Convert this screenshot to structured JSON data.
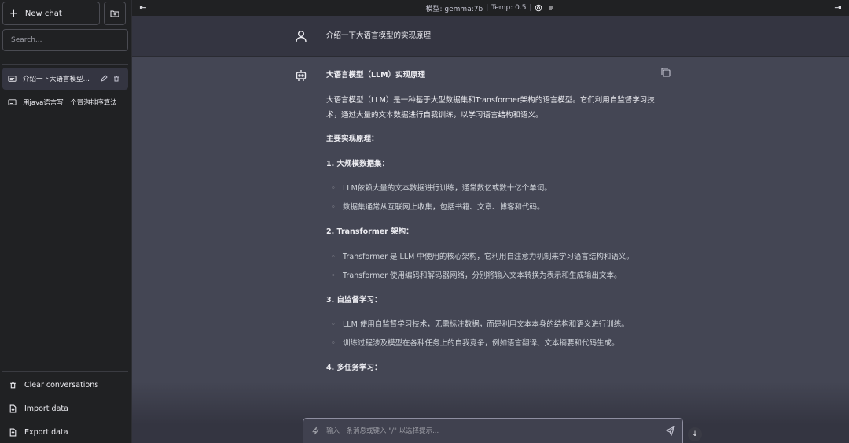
{
  "sidebar": {
    "new_chat_label": "New chat",
    "search_placeholder": "Search...",
    "conversations": [
      {
        "label": "介绍一下大语言模型的..."
      },
      {
        "label": "用java语言写一个冒泡排序算法"
      }
    ],
    "bottom": {
      "clear": "Clear conversations",
      "import": "Import data",
      "export": "Export data"
    }
  },
  "topbar": {
    "model": "模型: gemma:7b",
    "temp": "Temp: 0.5"
  },
  "user_message": "介绍一下大语言模型的实现原理",
  "assistant": {
    "title": "大语言模型（LLM）实现原理",
    "intro": "大语言模型（LLM）是一种基于大型数据集和Transformer架构的语言模型。它们利用自监督学习技术，通过大量的文本数据进行自我训练，以学习语言结构和语义。",
    "main_heading": "主要实现原理：",
    "sections": [
      {
        "heading": "1. 大规模数据集：",
        "items": [
          "LLM依赖大量的文本数据进行训练，通常数亿或数十亿个单词。",
          "数据集通常从互联网上收集，包括书籍、文章、博客和代码。"
        ]
      },
      {
        "heading": "2. Transformer 架构：",
        "items": [
          "Transformer 是 LLM 中使用的核心架构，它利用自注意力机制来学习语言结构和语义。",
          "Transformer 使用编码和解码器网络，分别将输入文本转换为表示和生成输出文本。"
        ]
      },
      {
        "heading": "3. 自监督学习：",
        "items": [
          "LLM 使用自监督学习技术，无需标注数据，而是利用文本本身的结构和语义进行训练。",
          "训练过程涉及模型在各种任务上的自我竞争，例如语言翻译、文本摘要和代码生成。"
        ]
      },
      {
        "heading": "4. 多任务学习：",
        "items": []
      }
    ]
  },
  "input": {
    "placeholder": "输入一条消息或键入 \"/\" 以选择提示..."
  },
  "icons": {
    "user": "user-icon",
    "bot": "robot-icon",
    "copy": "copy-icon",
    "send": "send-icon",
    "settings": "gear-icon",
    "prompt": "lightning-icon"
  }
}
